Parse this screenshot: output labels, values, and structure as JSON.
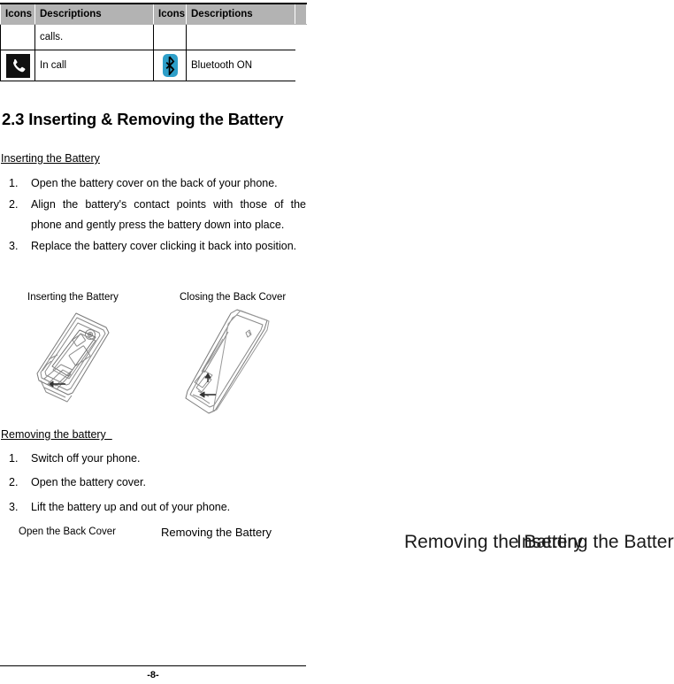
{
  "status_table": {
    "headers": [
      "Icons",
      "Descriptions",
      "Icons",
      "Descriptions",
      ""
    ],
    "rows": [
      {
        "icon_left": "",
        "desc_left": "calls.",
        "icon_right": "",
        "desc_right": ""
      },
      {
        "icon_left": "phone-handset-icon",
        "desc_left": "In call",
        "icon_right": "bluetooth-icon",
        "desc_right": "Bluetooth ON"
      }
    ]
  },
  "section": {
    "heading": "2.3 Inserting & Removing the Battery",
    "inserting": {
      "subheading": "Inserting the Battery",
      "steps": [
        {
          "num": "1.",
          "text": "Open the battery cover on the back of your phone."
        },
        {
          "num": "2.",
          "text": "Align the battery's contact points with those of the phone and gently press the battery down into place."
        },
        {
          "num": "3.",
          "text": "Replace the battery cover clicking it back into position."
        }
      ]
    },
    "removing": {
      "subheading": "Removing the battery  ",
      "steps": [
        {
          "num": "1.",
          "text": "Switch off your phone."
        },
        {
          "num": "2.",
          "text": "Open the battery cover."
        },
        {
          "num": "3.",
          "text": "Lift the battery up and out of your phone."
        }
      ]
    }
  },
  "figures": {
    "inserting_caption": "Inserting the Battery",
    "closing_caption": "Closing the Back Cover",
    "open_cover_caption": "Open the Back Cover",
    "removing_caption": "Removing the Battery"
  },
  "overlay_labels": {
    "removing": "Removing the Battery",
    "inserting": "Inserting the Battery"
  },
  "footer": {
    "page_number": "-8-"
  },
  "colors": {
    "table_header_bg": "#b3b3b3",
    "bluetooth_blue": "#2e9fc9",
    "icon_black": "#111111",
    "text": "#000000"
  }
}
